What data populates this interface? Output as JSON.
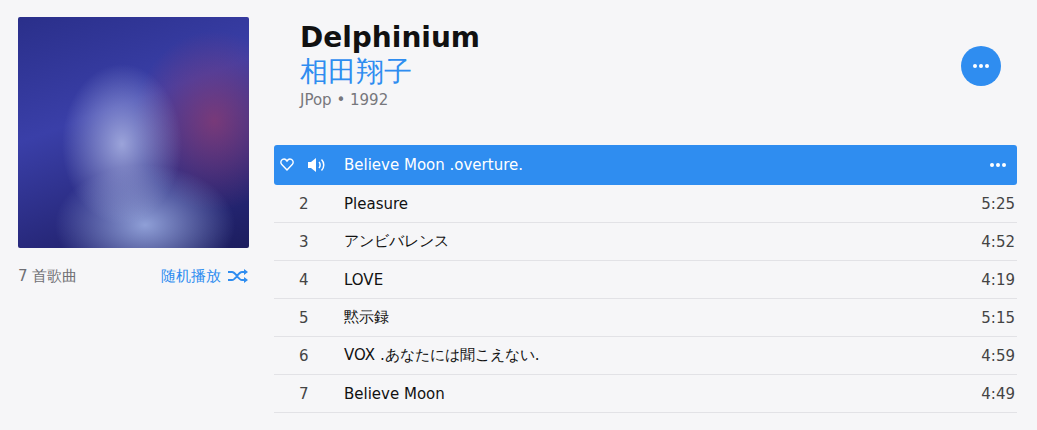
{
  "album": {
    "title": "Delphinium",
    "artist": "相田翔子",
    "meta": "JPop • 1992"
  },
  "song_count": "7 首歌曲",
  "shuffle": "随机播放",
  "tracks": [
    {
      "title": "Believe Moon .overture.",
      "selected": true,
      "playing": true
    },
    {
      "number": "2",
      "title": "Pleasure",
      "duration": "5:25",
      "selected": false,
      "playing": false
    },
    {
      "number": "3",
      "title": "アンビバレンス",
      "duration": "4:52",
      "selected": false,
      "playing": false
    },
    {
      "number": "4",
      "title": "LOVE",
      "duration": "4:19",
      "selected": false,
      "playing": false
    },
    {
      "number": "5",
      "title": "黙示録",
      "duration": "5:15",
      "selected": false,
      "playing": false
    },
    {
      "number": "6",
      "title": "VOX .あなたには聞こえない.",
      "duration": "4:59",
      "selected": false,
      "playing": false
    },
    {
      "number": "7",
      "title": "Believe Moon",
      "duration": "4:49",
      "selected": false,
      "playing": false
    }
  ]
}
